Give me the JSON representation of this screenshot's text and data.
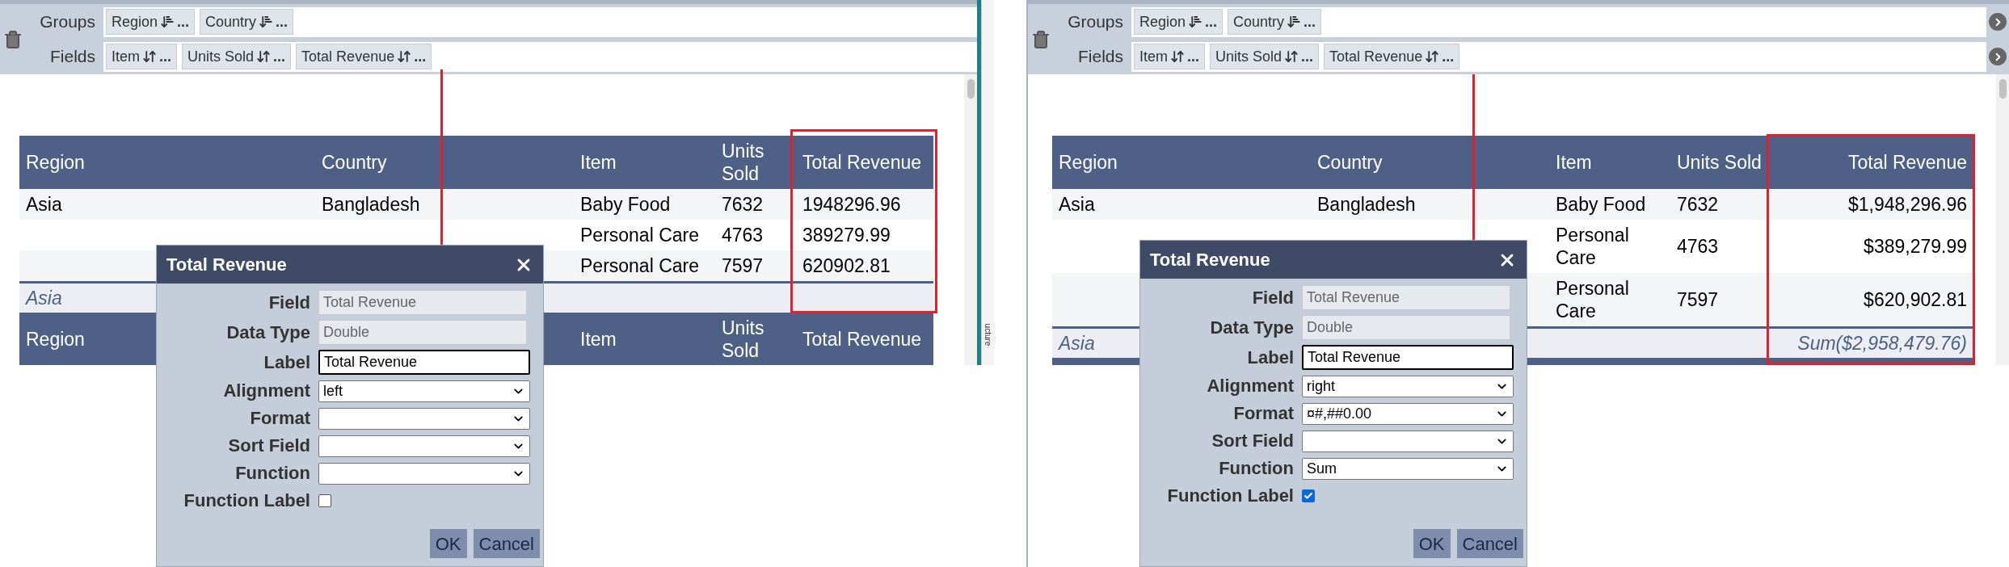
{
  "panels": [
    {
      "groups": {
        "label": "Groups",
        "chips": [
          {
            "label": "Region",
            "menu": "..."
          },
          {
            "label": "Country",
            "menu": "..."
          }
        ]
      },
      "fields": {
        "label": "Fields",
        "chips": [
          {
            "label": "Item",
            "menu": "..."
          },
          {
            "label": "Units Sold",
            "menu": "..."
          },
          {
            "label": "Total Revenue",
            "menu": "..."
          }
        ]
      },
      "scroll_buttons": false,
      "side_tab": "ucture",
      "table": {
        "columns": [
          {
            "label": "Region",
            "right_aligned": false
          },
          {
            "label": "Country",
            "right_aligned": false
          },
          {
            "label": "Item",
            "right_aligned": false
          },
          {
            "label": "Units Sold",
            "right_aligned": false
          },
          {
            "label": "Total Revenue",
            "right_aligned": false
          }
        ],
        "rows": [
          [
            "Asia",
            "Bangladesh",
            "Baby Food",
            "7632",
            "1948296.96"
          ],
          [
            "Personal Care",
            "4763",
            "389279.99"
          ],
          [
            "Personal Care",
            "7597",
            "620902.81"
          ]
        ],
        "group_footer": {
          "label": "Asia"
        },
        "repeat_header": [
          "Region",
          "Item",
          "Units Sold",
          "Total Revenue"
        ]
      },
      "dialog": {
        "title": "Total Revenue",
        "rows": [
          {
            "kind": "readonly",
            "label": "Field",
            "value": "Total Revenue"
          },
          {
            "kind": "readonly",
            "label": "Data Type",
            "value": "Double"
          },
          {
            "kind": "text",
            "label": "Label",
            "value": "Total Revenue"
          },
          {
            "kind": "select",
            "label": "Alignment",
            "value": "left"
          },
          {
            "kind": "select",
            "label": "Format"
          },
          {
            "kind": "select",
            "label": "Sort Field"
          },
          {
            "kind": "select",
            "label": "Function"
          },
          {
            "kind": "checkbox",
            "label": "Function Label",
            "checked": false
          }
        ],
        "buttons": [
          "OK",
          "Cancel"
        ]
      }
    },
    {
      "groups": {
        "label": "Groups",
        "chips": [
          {
            "label": "Region",
            "menu": "..."
          },
          {
            "label": "Country",
            "menu": "..."
          }
        ]
      },
      "fields": {
        "label": "Fields",
        "chips": [
          {
            "label": "Item",
            "menu": "..."
          },
          {
            "label": "Units Sold",
            "menu": "..."
          },
          {
            "label": "Total Revenue",
            "menu": "..."
          }
        ]
      },
      "scroll_buttons": true,
      "table": {
        "columns": [
          {
            "label": "Region",
            "right_aligned": false
          },
          {
            "label": "Country",
            "right_aligned": false
          },
          {
            "label": "Item",
            "right_aligned": false
          },
          {
            "label": "Units Sold",
            "right_aligned": false
          },
          {
            "label": "Total Revenue",
            "right_aligned": true
          }
        ],
        "rows": [
          [
            "Asia",
            "Bangladesh",
            "Baby Food",
            "7632",
            "$1,948,296.96"
          ],
          [
            "Personal Care",
            "4763",
            "$389,279.99"
          ],
          [
            "Personal Care",
            "7597",
            "$620,902.81"
          ]
        ],
        "group_footer": {
          "label": "Asia",
          "total": "Sum($2,958,479.76)"
        }
      },
      "dialog": {
        "title": "Total Revenue",
        "rows": [
          {
            "kind": "readonly",
            "label": "Field",
            "value": "Total Revenue"
          },
          {
            "kind": "readonly",
            "label": "Data Type",
            "value": "Double"
          },
          {
            "kind": "text",
            "label": "Label",
            "value": "Total Revenue"
          },
          {
            "kind": "select",
            "label": "Alignment",
            "value": "right"
          },
          {
            "kind": "select",
            "label": "Format",
            "value": "¤#,##0.00"
          },
          {
            "kind": "select",
            "label": "Sort Field"
          },
          {
            "kind": "select",
            "label": "Function",
            "value": "Sum"
          },
          {
            "kind": "checkbox",
            "label": "Function Label",
            "checked": true
          }
        ],
        "buttons": [
          "OK",
          "Cancel"
        ]
      }
    }
  ]
}
